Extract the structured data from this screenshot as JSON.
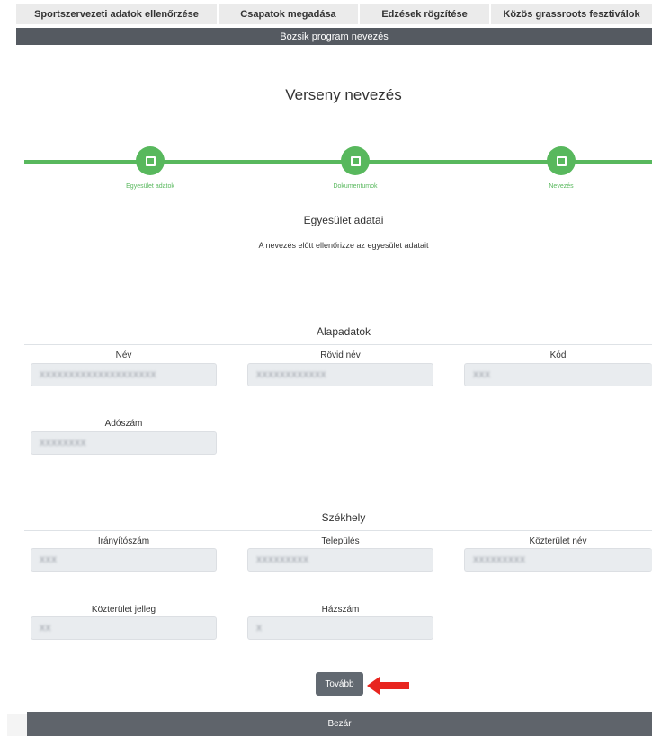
{
  "tabs": [
    "Sportszervezeti adatok ellenőrzése",
    "Csapatok megadása",
    "Edzések rögzítése",
    "Közös grassroots fesztiválok"
  ],
  "active_tab": "Bozsik program nevezés",
  "page_title": "Verseny nevezés",
  "steps": [
    "Egyesület adatok",
    "Dokumentumok",
    "Nevezés"
  ],
  "section": {
    "title": "Egyesület adatai",
    "subtitle": "A nevezés előtt ellenőrizze az egyesület adatait"
  },
  "alapadatok": {
    "title": "Alapadatok",
    "nev_label": "Név",
    "nev_value": "XXXXXXXXXXXXXXXXXXXX",
    "rovid_nev_label": "Rövid név",
    "rovid_nev_value": "XXXXXXXXXXXX",
    "kod_label": "Kód",
    "kod_value": "XXX",
    "adoszam_label": "Adószám",
    "adoszam_value": "XXXXXXXX"
  },
  "szekhely": {
    "title": "Székhely",
    "iranyitoszam_label": "Irányítószám",
    "iranyitoszam_value": "XXX",
    "telepules_label": "Település",
    "telepules_value": "XXXXXXXXX",
    "kozterulet_nev_label": "Közterület név",
    "kozterulet_nev_value": "XXXXXXXXX",
    "kozterulet_jelleg_label": "Közterület jelleg",
    "kozterulet_jelleg_value": "XX",
    "hazszam_label": "Házszám",
    "hazszam_value": "X"
  },
  "buttons": {
    "next": "Tovább",
    "close": "Bezár"
  },
  "colors": {
    "stepper": "#58b85d",
    "dark_bar": "#555a61",
    "arrow": "#e8251f"
  }
}
